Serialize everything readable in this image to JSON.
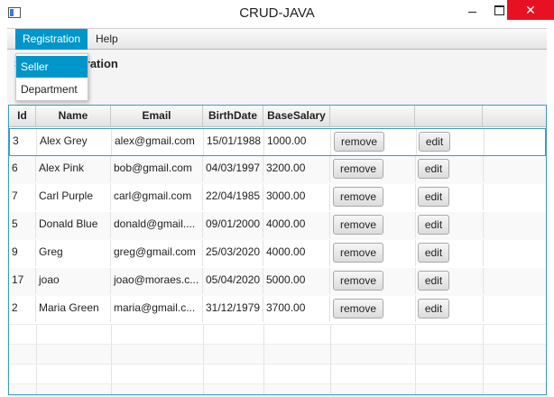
{
  "window": {
    "title": "CRUD-JAVA",
    "minimize_glyph": "",
    "close_glyph": "✕"
  },
  "menubar": {
    "items": [
      "Registration",
      "Help"
    ],
    "open_menu": "Registration"
  },
  "dropdown": {
    "items": [
      "Seller",
      "Department"
    ],
    "highlighted": "Seller"
  },
  "page": {
    "heading": "Seller Registration",
    "heading_visible": "ration"
  },
  "table": {
    "columns": [
      "Id",
      "Name",
      "Email",
      "BirthDate",
      "BaseSalary",
      "",
      ""
    ],
    "remove_label": "remove",
    "edit_label": "edit",
    "selected_row": 0,
    "rows": [
      {
        "id": "3",
        "name": "Alex Grey",
        "email": "alex@gmail.com",
        "birth": "15/01/1988",
        "salary": "1000.00"
      },
      {
        "id": "6",
        "name": "Alex Pink",
        "email": "bob@gmail.com",
        "birth": "04/03/1997",
        "salary": "3200.00"
      },
      {
        "id": "7",
        "name": "Carl Purple",
        "email": "carl@gmail.com",
        "birth": "22/04/1985",
        "salary": "3000.00"
      },
      {
        "id": "5",
        "name": "Donald Blue",
        "email": "donald@gmail....",
        "birth": "09/01/2000",
        "salary": "4000.00"
      },
      {
        "id": "9",
        "name": "Greg",
        "email": "greg@gmail.com",
        "birth": "25/03/2020",
        "salary": "4000.00"
      },
      {
        "id": "17",
        "name": "joao",
        "email": "joao@moraes.c...",
        "birth": "05/04/2020",
        "salary": "5000.00"
      },
      {
        "id": "2",
        "name": "Maria Green",
        "email": "maria@gmail.c...",
        "birth": "31/12/1979",
        "salary": "3700.00"
      }
    ]
  },
  "colors": {
    "accent": "#0096c9",
    "selection_border": "#3a9cc6",
    "close_button": "#e81123"
  }
}
